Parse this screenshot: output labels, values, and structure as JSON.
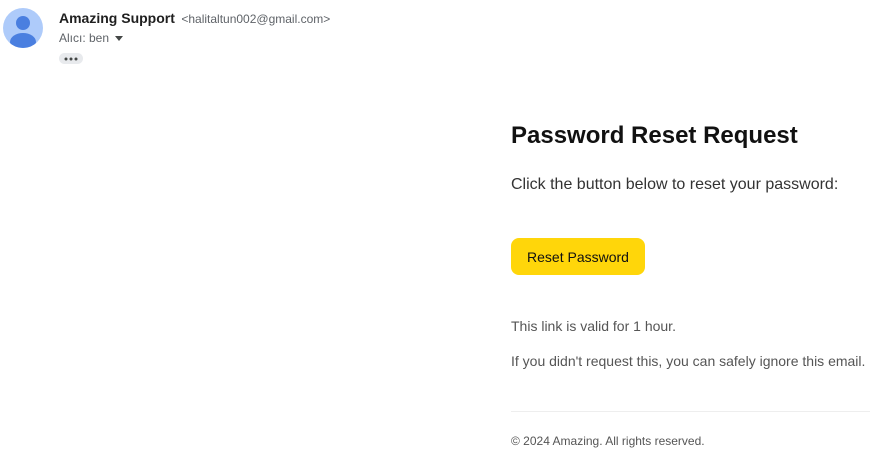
{
  "header": {
    "sender_name": "Amazing Support",
    "sender_email": "<halitaltun002@gmail.com>",
    "recipient_label": "Alıcı: ben",
    "avatar_icon": "person-icon",
    "avatar_color": "#aecbfa",
    "more_icon": "more-horizontal-icon"
  },
  "email": {
    "title": "Password Reset Request",
    "intro": "Click the button below to reset your password:",
    "button_label": "Reset Password",
    "button_color": "#ffd60a",
    "validity_text": "This link is valid for 1 hour.",
    "ignore_text": "If you didn't request this, you can safely ignore this email.",
    "footer": "© 2024 Amazing. All rights reserved."
  }
}
